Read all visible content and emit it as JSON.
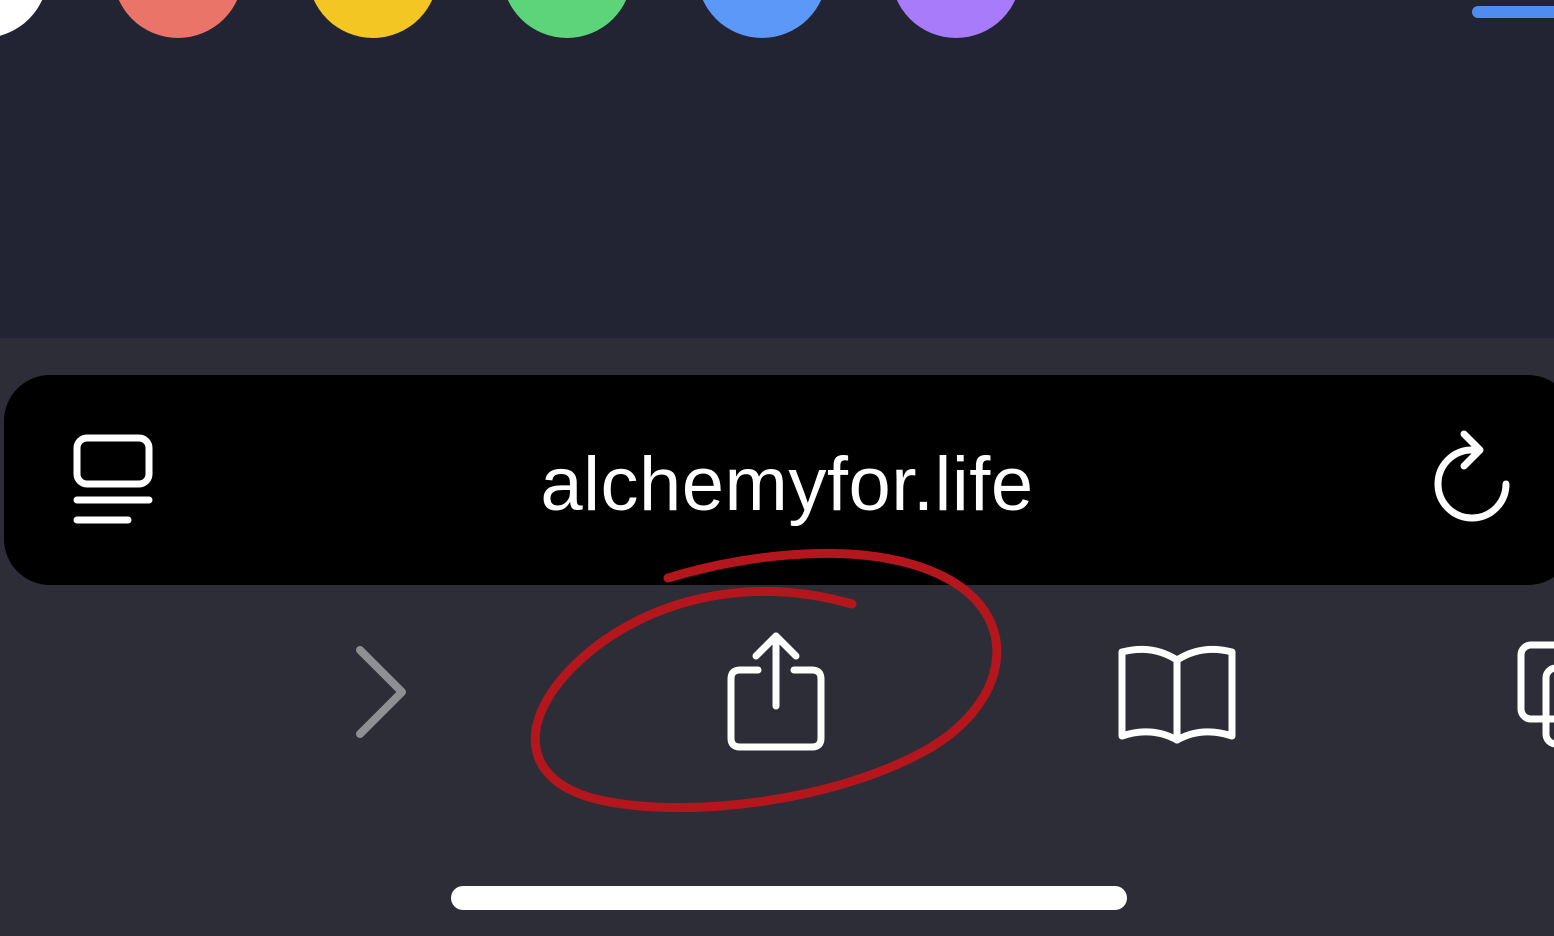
{
  "page": {
    "swatches": [
      {
        "name": "white",
        "color": "#ffffff"
      },
      {
        "name": "red",
        "color": "#ea7468"
      },
      {
        "name": "yellow",
        "color": "#f3c623"
      },
      {
        "name": "green",
        "color": "#5dd47a"
      },
      {
        "name": "blue",
        "color": "#5b98f7"
      },
      {
        "name": "purple",
        "color": "#a77bfa"
      }
    ],
    "menu_line_color": "#4e8cf0"
  },
  "address_bar": {
    "url": "alchemyfor.life",
    "reader_icon": "reader-mode-icon",
    "reload_icon": "reload-icon"
  },
  "toolbar": {
    "forward_icon": "chevron-right-icon",
    "share_icon": "share-icon",
    "bookmarks_icon": "bookmarks-book-icon",
    "tabs_icon": "tabs-icon"
  },
  "annotation": {
    "color": "#b3161c",
    "target": "share-button"
  }
}
